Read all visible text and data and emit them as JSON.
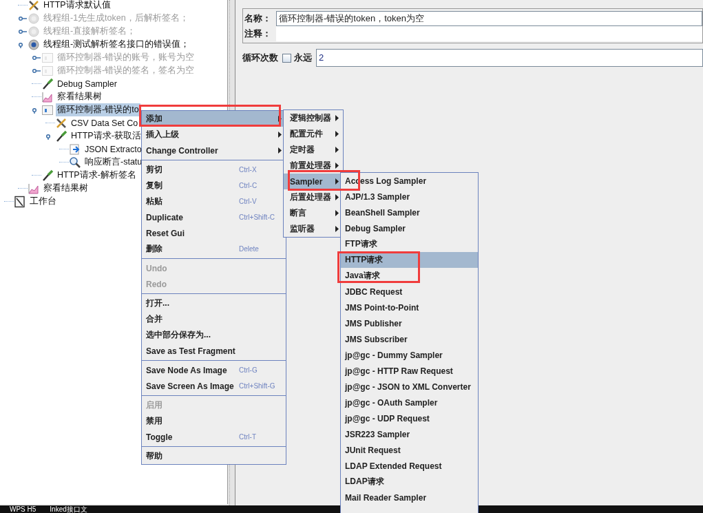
{
  "tree": {
    "items": [
      {
        "label": "HTTP请求默认值",
        "kind": "config",
        "disabled": false
      },
      {
        "label": "线程组-1先生成token，后解析签名；",
        "kind": "thread-group",
        "disabled": true,
        "expanded": false
      },
      {
        "label": "线程组-直接解析签名；",
        "kind": "thread-group",
        "disabled": true,
        "expanded": false
      },
      {
        "label": "线程组-测试解析签名接口的错误值；",
        "kind": "thread-group",
        "disabled": false,
        "expanded": true,
        "children": [
          {
            "label": "循环控制器-错误的账号，账号为空",
            "kind": "controller",
            "disabled": true,
            "expanded": false
          },
          {
            "label": "循环控制器-错误的签名，签名为空",
            "kind": "controller",
            "disabled": true,
            "expanded": false
          },
          {
            "label": "Debug Sampler",
            "kind": "sampler",
            "disabled": false
          },
          {
            "label": "察看结果树",
            "kind": "listener",
            "disabled": false
          },
          {
            "label": "循环控制器-错误的to",
            "kind": "controller",
            "disabled": false,
            "selected": true,
            "expanded": true,
            "children": [
              {
                "label": "CSV Data Set Co",
                "kind": "config",
                "disabled": false
              },
              {
                "label": "HTTP请求-获取活",
                "kind": "sampler",
                "disabled": false,
                "expanded": true,
                "children": [
                  {
                    "label": "JSON Extracto",
                    "kind": "extractor",
                    "disabled": false
                  },
                  {
                    "label": "响应断言-statu",
                    "kind": "assertion",
                    "disabled": false
                  }
                ]
              }
            ]
          },
          {
            "label": "HTTP请求-解析签名",
            "kind": "sampler",
            "disabled": false
          }
        ]
      },
      {
        "label": "察看结果树",
        "kind": "listener",
        "disabled": false
      }
    ],
    "workbench": {
      "label": "工作台",
      "kind": "workbench",
      "disabled": false
    }
  },
  "editor": {
    "name_label": "名称：",
    "name_value": "循环控制器-错误的token，token为空",
    "comment_label": "注释：",
    "loop_label": "循环次数",
    "forever": {
      "label": "永远",
      "checked": false
    },
    "loop_value": "2"
  },
  "context_menu": {
    "groups": [
      [
        {
          "text": "添加",
          "submenu": true,
          "selected": true
        },
        {
          "text": "插入上级",
          "submenu": true,
          "selected": false
        },
        {
          "text": "Change Controller",
          "submenu": true,
          "selected": false
        }
      ],
      [
        {
          "text": "剪切",
          "shortcut": "Ctrl-X",
          "selected": false
        },
        {
          "text": "复制",
          "shortcut": "Ctrl-C",
          "selected": false
        },
        {
          "text": "粘贴",
          "shortcut": "Ctrl-V",
          "selected": false
        },
        {
          "text": "Duplicate",
          "shortcut": "Ctrl+Shift-C",
          "selected": false
        },
        {
          "text": "Reset Gui",
          "selected": false
        },
        {
          "text": "删除",
          "shortcut": "Delete",
          "selected": false
        }
      ],
      [
        {
          "text": "Undo",
          "disabled": true,
          "selected": false
        },
        {
          "text": "Redo",
          "disabled": true,
          "selected": false
        }
      ],
      [
        {
          "text": "打开...",
          "selected": false
        },
        {
          "text": "合并",
          "selected": false
        },
        {
          "text": "选中部分保存为...",
          "selected": false
        },
        {
          "text": "Save as Test Fragment",
          "selected": false
        }
      ],
      [
        {
          "text": "Save Node As Image",
          "shortcut": "Ctrl-G",
          "selected": false
        },
        {
          "text": "Save Screen As Image",
          "shortcut": "Ctrl+Shift-G",
          "selected": false
        }
      ],
      [
        {
          "text": "启用",
          "disabled": true,
          "selected": false
        },
        {
          "text": "禁用",
          "selected": false
        },
        {
          "text": "Toggle",
          "shortcut": "Ctrl-T",
          "selected": false
        }
      ],
      [
        {
          "text": "帮助",
          "selected": false
        }
      ]
    ]
  },
  "add_menu": {
    "items": [
      {
        "text": "逻辑控制器",
        "selected": false
      },
      {
        "text": "配置元件",
        "selected": false
      },
      {
        "text": "定时器",
        "selected": false
      },
      {
        "text": "前置处理器",
        "selected": false
      },
      {
        "text": "Sampler",
        "selected": true
      },
      {
        "text": "后置处理器",
        "selected": false
      },
      {
        "text": "断言",
        "selected": false
      },
      {
        "text": "监听器",
        "selected": false
      }
    ]
  },
  "sampler_menu": {
    "items": [
      {
        "text": "Access Log Sampler",
        "selected": false
      },
      {
        "text": "AJP/1.3 Sampler",
        "selected": false
      },
      {
        "text": "BeanShell Sampler",
        "selected": false
      },
      {
        "text": "Debug Sampler",
        "selected": false
      },
      {
        "text": "FTP请求",
        "selected": false
      },
      {
        "text": "HTTP请求",
        "selected": true
      },
      {
        "text": "Java请求",
        "selected": false
      },
      {
        "text": "JDBC Request",
        "selected": false
      },
      {
        "text": "JMS Point-to-Point",
        "selected": false
      },
      {
        "text": "JMS Publisher",
        "selected": false
      },
      {
        "text": "JMS Subscriber",
        "selected": false
      },
      {
        "text": "jp@gc - Dummy Sampler",
        "selected": false
      },
      {
        "text": "jp@gc - HTTP Raw Request",
        "selected": false
      },
      {
        "text": "jp@gc - JSON to XML Converter",
        "selected": false
      },
      {
        "text": "jp@gc - OAuth Sampler",
        "selected": false
      },
      {
        "text": "jp@gc - UDP Request",
        "selected": false
      },
      {
        "text": "JSR223 Sampler",
        "selected": false
      },
      {
        "text": "JUnit Request",
        "selected": false
      },
      {
        "text": "LDAP Extended Request",
        "selected": false
      },
      {
        "text": "LDAP请求",
        "selected": false
      },
      {
        "text": "Mail Reader Sampler",
        "selected": false
      }
    ]
  },
  "taskbar": {
    "items": [
      "WPS H5",
      "Inked接口文"
    ]
  }
}
